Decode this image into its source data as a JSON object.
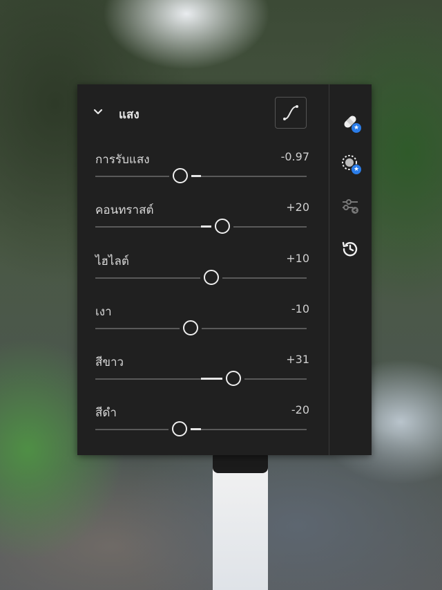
{
  "panel": {
    "section_title": "แสง",
    "sliders": [
      {
        "label": "การรับแสง",
        "value_text": "-0.97",
        "value": -0.97,
        "min": -5,
        "max": 5
      },
      {
        "label": "คอนทราสต์",
        "value_text": "+20",
        "value": 20,
        "min": -100,
        "max": 100
      },
      {
        "label": "ไฮไลต์",
        "value_text": "+10",
        "value": 10,
        "min": -100,
        "max": 100
      },
      {
        "label": "เงา",
        "value_text": "-10",
        "value": -10,
        "min": -100,
        "max": 100
      },
      {
        "label": "สีขาว",
        "value_text": "+31",
        "value": 31,
        "min": -100,
        "max": 100
      },
      {
        "label": "สีดำ",
        "value_text": "-20",
        "value": -20,
        "min": -100,
        "max": 100
      }
    ]
  },
  "side_tools": [
    {
      "icon": "healing-bandage-icon",
      "badge": "premium-star"
    },
    {
      "icon": "masking-circle-icon",
      "badge": "premium-star"
    },
    {
      "icon": "presets-sliders-icon",
      "badge": "none",
      "disabled": true
    },
    {
      "icon": "history-clock-icon",
      "badge": "none"
    }
  ],
  "colors": {
    "panel_bg": "#202020",
    "accent_badge": "#2b7de9",
    "text_primary": "#e8e8e8"
  }
}
